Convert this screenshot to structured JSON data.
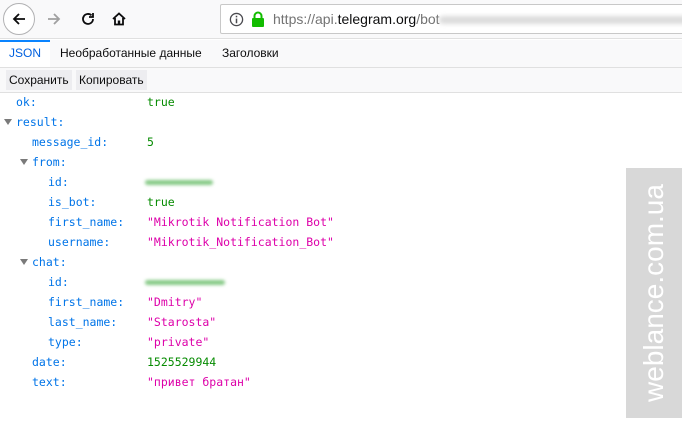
{
  "browser": {
    "url_prefix": "https://api.",
    "url_domain": "telegram.org",
    "url_suffix": "/bot"
  },
  "viewer": {
    "tabs": [
      {
        "label": "JSON",
        "active": true
      },
      {
        "label": "Необработанные данные",
        "active": false
      },
      {
        "label": "Заголовки",
        "active": false
      }
    ],
    "actions": {
      "save": "Сохранить",
      "copy": "Копировать"
    }
  },
  "tree": [
    {
      "key": "ok:",
      "value": "true",
      "type": "bool"
    },
    {
      "key": "result:",
      "expanded": true
    },
    {
      "key": "message_id:",
      "value": "5",
      "type": "num"
    },
    {
      "key": "from:",
      "expanded": true
    },
    {
      "key": "id:",
      "redacted": true
    },
    {
      "key": "is_bot:",
      "value": "true",
      "type": "bool"
    },
    {
      "key": "first_name:",
      "value": "\"Mikrotik Notification Bot\"",
      "type": "str"
    },
    {
      "key": "username:",
      "value": "\"Mikrotik_Notification_Bot\"",
      "type": "str"
    },
    {
      "key": "chat:",
      "expanded": true
    },
    {
      "key": "id:",
      "redacted": true
    },
    {
      "key": "first_name:",
      "value": "\"Dmitry\"",
      "type": "str"
    },
    {
      "key": "last_name:",
      "value": "\"Starosta\"",
      "type": "str"
    },
    {
      "key": "type:",
      "value": "\"private\"",
      "type": "str"
    },
    {
      "key": "date:",
      "value": "1525529944",
      "type": "num"
    },
    {
      "key": "text:",
      "value": "\"привет братан\"",
      "type": "str"
    }
  ],
  "watermark": "weblance.com.ua",
  "colors": {
    "key": "#0074e8",
    "string": "#dd00a9",
    "number_bool": "#058b00",
    "active_tab": "#0a84ff"
  }
}
